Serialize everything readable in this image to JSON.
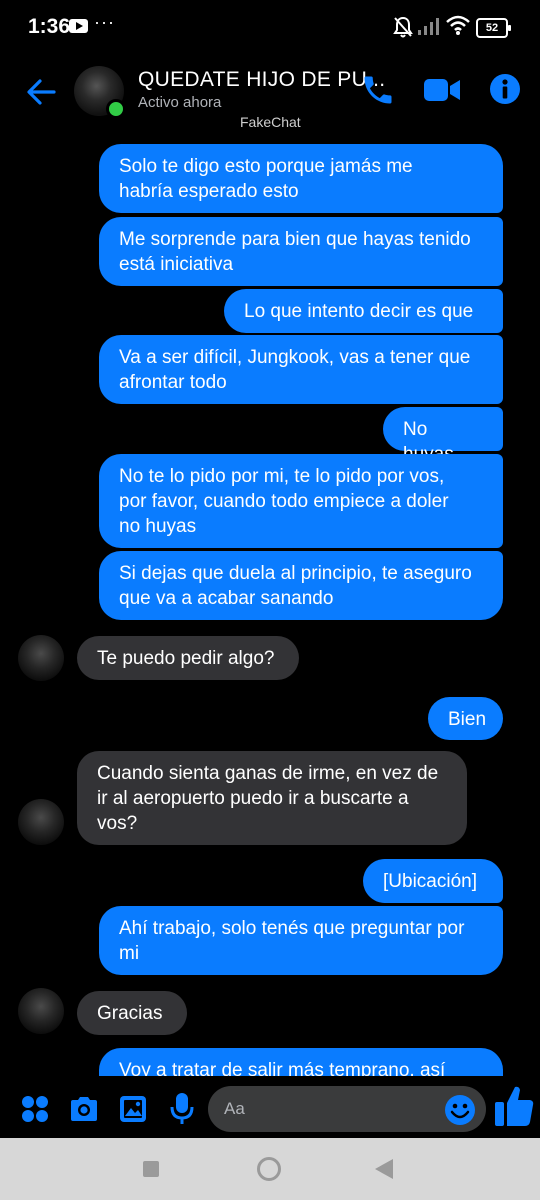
{
  "status_bar": {
    "time": "1:36",
    "battery": "52"
  },
  "header": {
    "contact_name": "QUEDATE HIJO DE PU...",
    "contact_status": "Activo ahora",
    "watermark": "FakeChat"
  },
  "messages": [
    {
      "dir": "out",
      "text": "Solo te digo esto porque jamás me\nhabría esperado esto"
    },
    {
      "dir": "out",
      "text": "Me sorprende para bien que hayas tenido\nestá iniciativa"
    },
    {
      "dir": "out",
      "text": "Lo que intento decir es que"
    },
    {
      "dir": "out",
      "text": "Va a ser difícil, Jungkook, vas a tener que\nafrontar todo"
    },
    {
      "dir": "out",
      "text": "No huyas"
    },
    {
      "dir": "out",
      "text": "No te lo pido por mi, te lo pido por vos,\npor favor, cuando todo empiece a doler\nno huyas"
    },
    {
      "dir": "out",
      "text": "Si dejas que duela al principio, te aseguro\nque va a acabar sanando"
    },
    {
      "dir": "in",
      "text": "Te puedo pedir algo?"
    },
    {
      "dir": "out",
      "text": "Bien"
    },
    {
      "dir": "in",
      "text": "Cuando sienta ganas de irme, en vez de\nir al aeropuerto puedo ir a buscarte a\nvos?"
    },
    {
      "dir": "out",
      "text": "[Ubicación]"
    },
    {
      "dir": "out",
      "text": "Ahí trabajo, solo tenés que preguntar por\nmi"
    },
    {
      "dir": "in",
      "text": "Gracias"
    },
    {
      "dir": "out",
      "text": "Voy a tratar de salir más temprano, así"
    }
  ],
  "composer": {
    "placeholder": "Aa"
  },
  "colors": {
    "accent": "#0a7cff",
    "incoming_bubble": "#333336",
    "online": "#31cc46"
  }
}
